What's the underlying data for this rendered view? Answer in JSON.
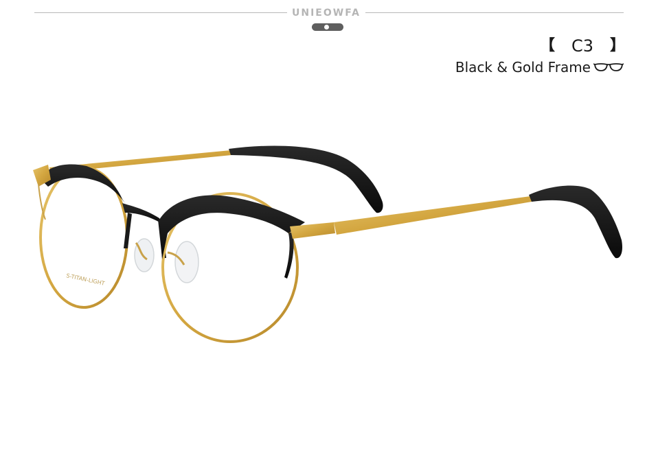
{
  "header": {
    "brand": "UNIEOWFA"
  },
  "variant": {
    "bracket_open": "【",
    "code": "C3",
    "bracket_close": "】",
    "name": "Black & Gold Frame"
  },
  "product_image": {
    "temple_engraving": "S-TITAN-LIGHT"
  },
  "colors": {
    "frame_black": "#141414",
    "frame_gold": "#d6aa45",
    "rule": "#b8b8b8",
    "pager": "#5f5f5f",
    "brand_text": "#b5b5b5"
  },
  "icons": {
    "variant_icon": "glasses-icon"
  }
}
